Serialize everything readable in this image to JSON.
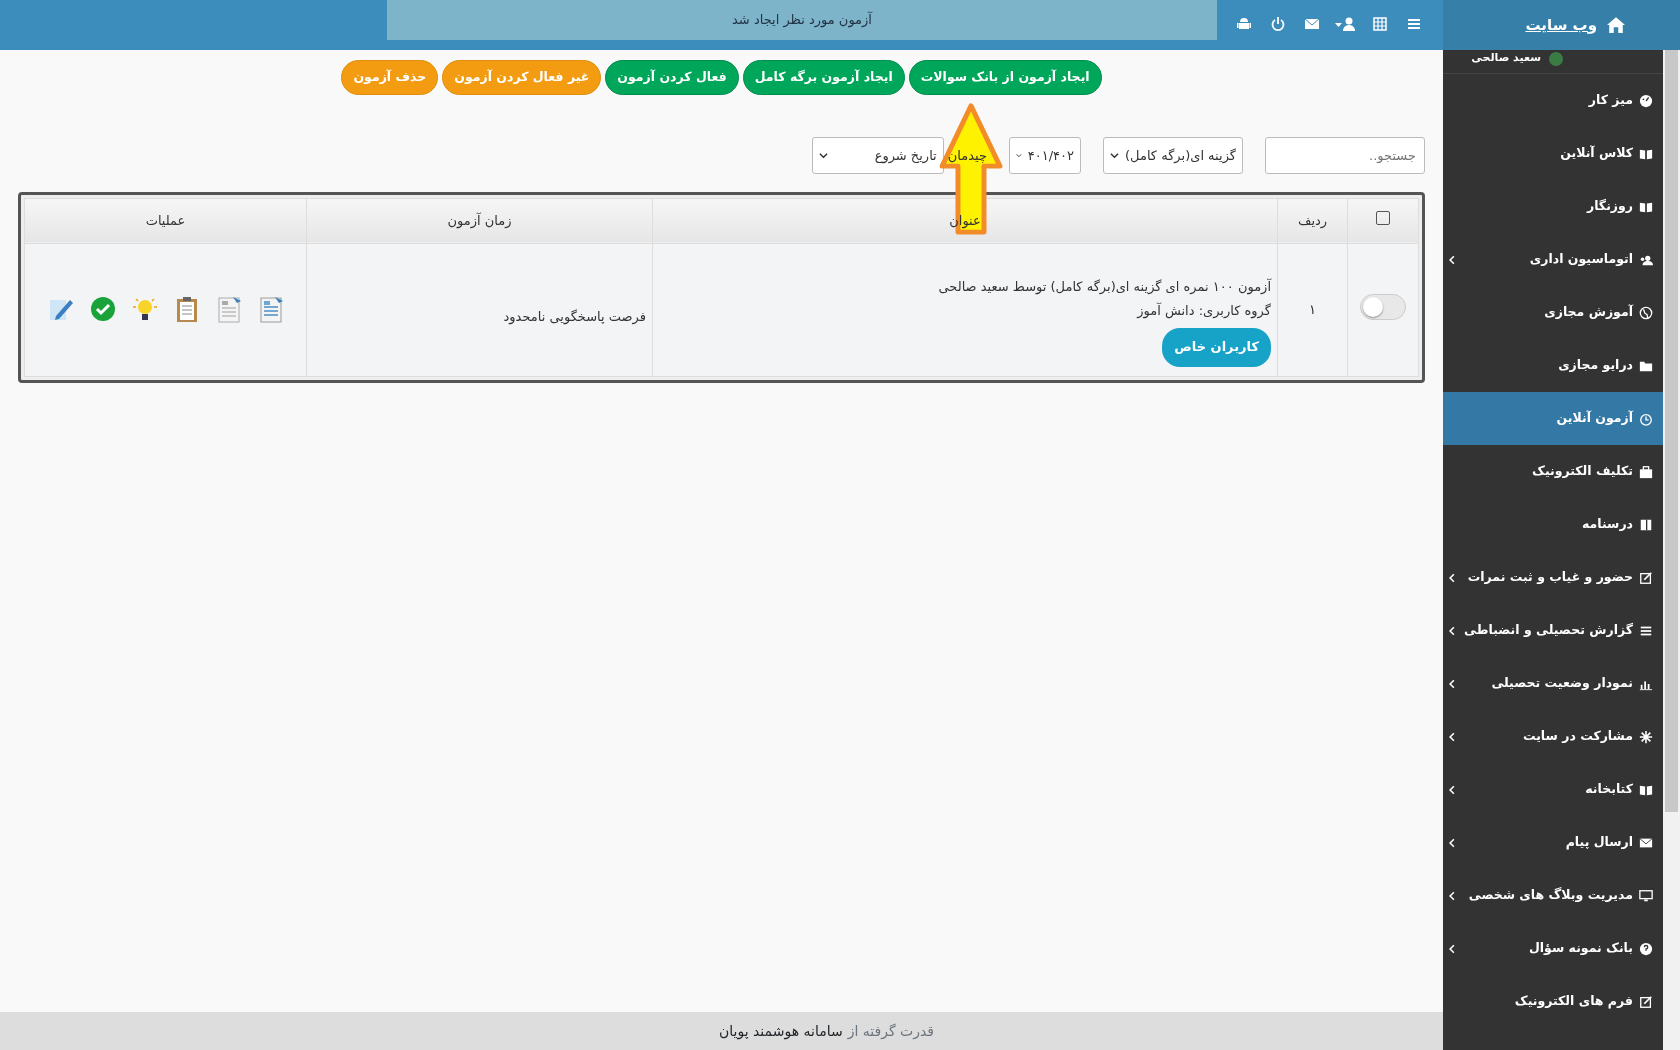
{
  "topbar": {
    "brand": "وب سایت",
    "notice": "آزمون مورد نظر ایجاد شد"
  },
  "user": {
    "name": "سعید صالحی",
    "online": true
  },
  "sidebar": {
    "items": [
      {
        "label": "میز کار",
        "expandable": false,
        "selected": false
      },
      {
        "label": "کلاس آنلاین",
        "expandable": false,
        "selected": false
      },
      {
        "label": "روزنگار",
        "expandable": false,
        "selected": false
      },
      {
        "label": "اتوماسیون اداری",
        "expandable": true,
        "selected": false
      },
      {
        "label": "آموزش مجازی",
        "expandable": false,
        "selected": false
      },
      {
        "label": "درایو مجازی",
        "expandable": false,
        "selected": false
      },
      {
        "label": "آزمون آنلاین",
        "expandable": false,
        "selected": true
      },
      {
        "label": "تکلیف الکترونیک",
        "expandable": false,
        "selected": false
      },
      {
        "label": "درسنامه",
        "expandable": false,
        "selected": false
      },
      {
        "label": "حضور و غیاب و ثبت نمرات",
        "expandable": true,
        "selected": false
      },
      {
        "label": "گزارش تحصیلی و انضباطی",
        "expandable": true,
        "selected": false
      },
      {
        "label": "نمودار وضعیت تحصیلی",
        "expandable": true,
        "selected": false
      },
      {
        "label": "مشارکت در سایت",
        "expandable": true,
        "selected": false
      },
      {
        "label": "کتابخانه",
        "expandable": true,
        "selected": false
      },
      {
        "label": "ارسال پیام",
        "expandable": true,
        "selected": false
      },
      {
        "label": "مدیریت وبلاگ های شخصی",
        "expandable": true,
        "selected": false
      },
      {
        "label": "بانک نمونه سؤال",
        "expandable": true,
        "selected": false
      },
      {
        "label": "فرم های الکترونیک",
        "expandable": false,
        "selected": false
      }
    ]
  },
  "actions": [
    {
      "label": "ایجاد آزمون از بانک سوالات",
      "kind": "success"
    },
    {
      "label": "ایجاد آزمون برگه کامل",
      "kind": "success"
    },
    {
      "label": "فعال کردن آزمون",
      "kind": "success"
    },
    {
      "label": "غیر فعال کردن آزمون",
      "kind": "warning"
    },
    {
      "label": "حذف آزمون",
      "kind": "warning"
    }
  ],
  "filters": {
    "search": {
      "placeholder": "جستجو.."
    },
    "type": "گزینه ای(برگه کامل)",
    "year": "۴۰۱/۴۰۲",
    "sort_label": "چیدمان",
    "sort": "تاریخ شروع"
  },
  "table": {
    "select_all": {
      "checked": false
    },
    "columns": [
      "ردیف",
      "عنوان",
      "زمان آزمون",
      "عملیات"
    ],
    "rows": [
      {
        "on": false,
        "index": "۱",
        "title": "آزمون ۱۰۰ نمره ای گزینه ای(برگه کامل) توسط سعید صالحی",
        "group": "گروه کاربری: دانش آموز",
        "tag": "کاربران خاص",
        "time": "فرصت پاسخگویی نامحدود"
      }
    ]
  },
  "footer": {
    "prefix": "قدرت گرفته از",
    "brand": "سامانه هوشمند پویان"
  }
}
